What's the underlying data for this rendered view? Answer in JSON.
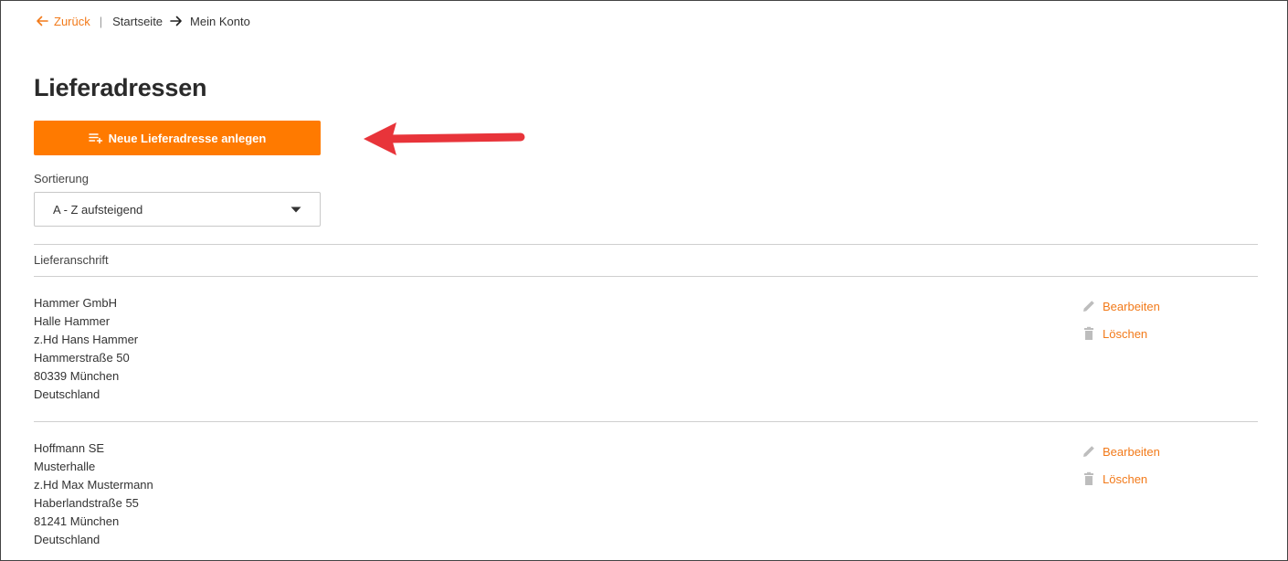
{
  "breadcrumb": {
    "back_label": "Zurück",
    "separator": "|",
    "home_label": "Startseite",
    "current_label": "Mein Konto"
  },
  "page": {
    "title": "Lieferadressen",
    "new_button_label": "Neue Lieferadresse anlegen"
  },
  "sort": {
    "label": "Sortierung",
    "selected": "A - Z aufsteigend"
  },
  "list": {
    "column_header": "Lieferanschrift",
    "edit_label": "Bearbeiten",
    "delete_label": "Löschen",
    "addresses": [
      {
        "company": "Hammer GmbH",
        "hall": "Halle Hammer",
        "contact": "z.Hd Hans Hammer",
        "street": "Hammerstraße 50",
        "city": "80339 München",
        "country": "Deutschland"
      },
      {
        "company": "Hoffmann SE",
        "hall": "Musterhalle",
        "contact": "z.Hd Max Mustermann",
        "street": "Haberlandstraße 55",
        "city": "81241 München",
        "country": "Deutschland"
      }
    ]
  },
  "colors": {
    "accent": "#f27a1a",
    "button": "#ff7a00",
    "annotation_arrow": "#e8343a",
    "divider": "#cfcfcf"
  },
  "icons": {
    "back": "arrow-left-icon",
    "breadcrumb_separator": "arrow-right-icon",
    "new_button": "playlist-add-icon",
    "select": "caret-down-icon",
    "edit": "pencil-icon",
    "delete": "trash-icon",
    "annotation": "red-arrow-icon"
  }
}
